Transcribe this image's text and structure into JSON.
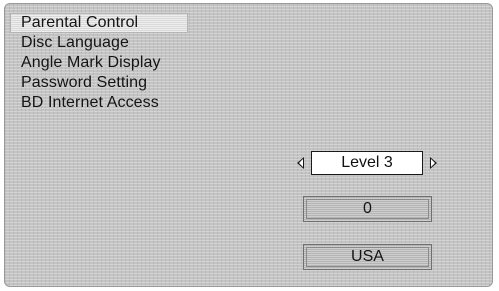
{
  "menu": {
    "items": [
      {
        "label": "Parental Control",
        "selected": true
      },
      {
        "label": "Disc Language",
        "selected": false
      },
      {
        "label": "Angle Mark Display",
        "selected": false
      },
      {
        "label": "Password Setting",
        "selected": false
      },
      {
        "label": "BD Internet Access",
        "selected": false
      }
    ]
  },
  "settings": {
    "parental_level": "Level 3",
    "password_value": "0",
    "country_code": "USA"
  },
  "colors": {
    "panel_background": "#c4c4c4",
    "text": "#141414",
    "level_box_background": "#ffffff"
  }
}
